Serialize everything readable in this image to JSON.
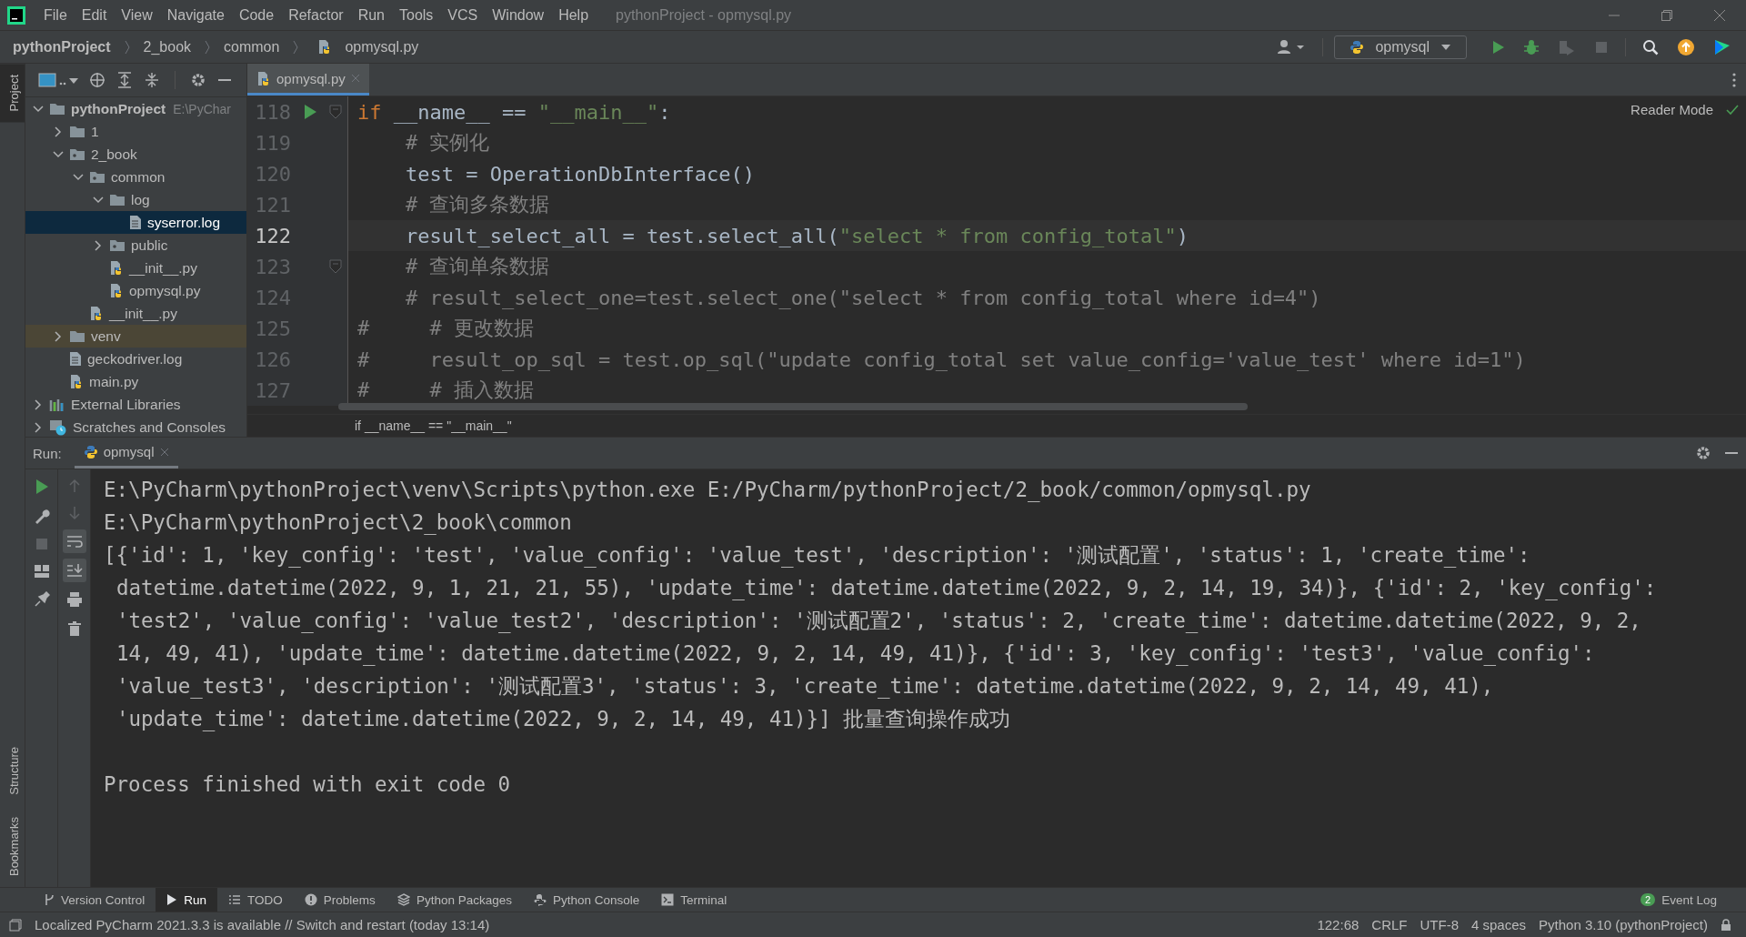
{
  "window": {
    "title": "pythonProject - opmysql.py"
  },
  "menu": [
    "File",
    "Edit",
    "View",
    "Navigate",
    "Code",
    "Refactor",
    "Run",
    "Tools",
    "VCS",
    "Window",
    "Help"
  ],
  "breadcrumbs": [
    {
      "label": "pythonProject",
      "kind": "project"
    },
    {
      "label": "2_book",
      "kind": "folder"
    },
    {
      "label": "common",
      "kind": "folder"
    },
    {
      "label": "opmysql.py",
      "kind": "python"
    }
  ],
  "run_config": {
    "label": "opmysql"
  },
  "side_tabs": [
    {
      "label": "Project",
      "selected": true,
      "kind": "top"
    },
    {
      "label": "Structure",
      "selected": false,
      "kind": "bottom"
    },
    {
      "label": "Bookmarks",
      "selected": false,
      "kind": "bottom"
    }
  ],
  "project_tree": [
    {
      "label": "pythonProject",
      "hint": "E:\\PyChar",
      "kind": "folder",
      "expanded": true,
      "selected": false,
      "excluded": false,
      "children": [
        {
          "label": "1",
          "kind": "folder",
          "expanded": false,
          "selected": false,
          "excluded": false
        },
        {
          "label": "2_book",
          "kind": "module",
          "expanded": true,
          "selected": false,
          "excluded": false,
          "children": [
            {
              "label": "common",
              "kind": "module",
              "expanded": true,
              "selected": false,
              "excluded": false,
              "children": [
                {
                  "label": "log",
                  "kind": "folder",
                  "expanded": true,
                  "selected": false,
                  "excluded": false,
                  "children": [
                    {
                      "label": "syserror.log",
                      "kind": "text",
                      "selected": true,
                      "excluded": false
                    }
                  ]
                },
                {
                  "label": "public",
                  "kind": "module",
                  "expanded": false,
                  "selected": false,
                  "excluded": false
                },
                {
                  "label": "__init__.py",
                  "kind": "python",
                  "selected": false,
                  "excluded": false
                },
                {
                  "label": "opmysql.py",
                  "kind": "python",
                  "selected": false,
                  "excluded": false
                }
              ]
            },
            {
              "label": "__init__.py",
              "kind": "python",
              "selected": false,
              "excluded": false
            }
          ]
        },
        {
          "label": "venv",
          "kind": "folder",
          "expanded": false,
          "selected": false,
          "excluded": true
        },
        {
          "label": "geckodriver.log",
          "kind": "text",
          "selected": false,
          "excluded": false
        },
        {
          "label": "main.py",
          "kind": "python",
          "selected": false,
          "excluded": false
        }
      ]
    },
    {
      "label": "External Libraries",
      "kind": "libraries",
      "expanded": false,
      "selected": false,
      "excluded": false
    },
    {
      "label": "Scratches and Consoles",
      "kind": "scratches",
      "expanded": false,
      "selected": false,
      "excluded": false
    }
  ],
  "editor": {
    "tab": {
      "label": "opmysql.py",
      "selected": true
    },
    "reader_mode": "Reader Mode",
    "breadcrumb": "if __name__ == \"__main__\"",
    "lines": [
      {
        "number": "118",
        "current": false,
        "run_marker": true,
        "fold": true,
        "tokens": [
          {
            "kind": "keyword",
            "text": "if"
          },
          {
            "kind": "plain",
            "text": " __name__ == "
          },
          {
            "kind": "string",
            "text": "\"__main__\""
          },
          {
            "kind": "plain",
            "text": ":"
          }
        ]
      },
      {
        "number": "119",
        "current": false,
        "run_marker": false,
        "fold": false,
        "tokens": [
          {
            "kind": "comment",
            "text": "    # 实例化"
          }
        ]
      },
      {
        "number": "120",
        "current": false,
        "run_marker": false,
        "fold": false,
        "tokens": [
          {
            "kind": "plain",
            "text": "    test = OperationDbInterface()"
          }
        ]
      },
      {
        "number": "121",
        "current": false,
        "run_marker": false,
        "fold": false,
        "tokens": [
          {
            "kind": "comment",
            "text": "    # 查询多条数据"
          }
        ]
      },
      {
        "number": "122",
        "current": true,
        "run_marker": false,
        "fold": false,
        "tokens": [
          {
            "kind": "plain",
            "text": "    result_select_all = test.select_all("
          },
          {
            "kind": "string",
            "text": "\"select * from config_total\""
          },
          {
            "kind": "plain",
            "text": ")"
          }
        ]
      },
      {
        "number": "123",
        "current": false,
        "run_marker": false,
        "fold": true,
        "tokens": [
          {
            "kind": "comment",
            "text": "    # 查询单条数据"
          }
        ]
      },
      {
        "number": "124",
        "current": false,
        "run_marker": false,
        "fold": false,
        "tokens": [
          {
            "kind": "comment",
            "text": "    # result_select_one=test.select_one(\"select * from config_total where id=4\")"
          }
        ]
      },
      {
        "number": "125",
        "current": false,
        "run_marker": false,
        "fold": false,
        "tokens": [
          {
            "kind": "comment",
            "text": "#     # 更改数据"
          }
        ]
      },
      {
        "number": "126",
        "current": false,
        "run_marker": false,
        "fold": false,
        "tokens": [
          {
            "kind": "comment",
            "text": "#     result_op_sql = test.op_sql(\"update config_total set value_config='value_test' where id=1\")"
          }
        ]
      },
      {
        "number": "127",
        "current": false,
        "run_marker": false,
        "fold": false,
        "tokens": [
          {
            "kind": "comment",
            "text": "#     # 插入数据"
          }
        ]
      }
    ]
  },
  "run": {
    "label": "Run:",
    "tab": {
      "label": "opmysql",
      "selected": true
    },
    "output": [
      {
        "kind": "line",
        "text": "E:\\PyCharm\\pythonProject\\venv\\Scripts\\python.exe E:/PyCharm/pythonProject/2_book/common/opmysql.py"
      },
      {
        "kind": "line",
        "text": "E:\\PyCharm\\pythonProject\\2_book\\common"
      },
      {
        "kind": "line",
        "text": "[{'id': 1, 'key_config': 'test', 'value_config': 'value_test', 'description': '测试配置', 'status': 1, 'create_time':"
      },
      {
        "kind": "continuation",
        "text": "datetime.datetime(2022, 9, 1, 21, 21, 55), 'update_time': datetime.datetime(2022, 9, 2, 14, 19, 34)}, {'id': 2, 'key_config':"
      },
      {
        "kind": "continuation",
        "text": "'test2', 'value_config': 'value_test2', 'description': '测试配置2', 'status': 2, 'create_time': datetime.datetime(2022, 9, 2,"
      },
      {
        "kind": "continuation",
        "text": "14, 49, 41), 'update_time': datetime.datetime(2022, 9, 2, 14, 49, 41)}, {'id': 3, 'key_config': 'test3', 'value_config':"
      },
      {
        "kind": "continuation",
        "text": "'value_test3', 'description': '测试配置3', 'status': 3, 'create_time': datetime.datetime(2022, 9, 2, 14, 49, 41),"
      },
      {
        "kind": "continuation",
        "text": "'update_time': datetime.datetime(2022, 9, 2, 14, 49, 41)}] 批量查询操作成功"
      },
      {
        "kind": "blank"
      },
      {
        "kind": "line",
        "text": "Process finished with exit code 0"
      }
    ]
  },
  "tool_windows": [
    {
      "label": "Version Control",
      "kind": "vcs",
      "selected": false
    },
    {
      "label": "Run",
      "kind": "run",
      "selected": true
    },
    {
      "label": "TODO",
      "kind": "todo",
      "selected": false
    },
    {
      "label": "Problems",
      "kind": "problems",
      "selected": false
    },
    {
      "label": "Python Packages",
      "kind": "packages",
      "selected": false
    },
    {
      "label": "Python Console",
      "kind": "console",
      "selected": false
    },
    {
      "label": "Terminal",
      "kind": "terminal",
      "selected": false
    }
  ],
  "event_log": {
    "count": "2",
    "label": "Event Log"
  },
  "status_bar": {
    "message": "Localized PyCharm 2021.3.3 is available // Switch and restart (today 13:14)",
    "items": [
      "122:68",
      "CRLF",
      "UTF-8",
      "4 spaces",
      "Python 3.10 (pythonProject)"
    ]
  }
}
